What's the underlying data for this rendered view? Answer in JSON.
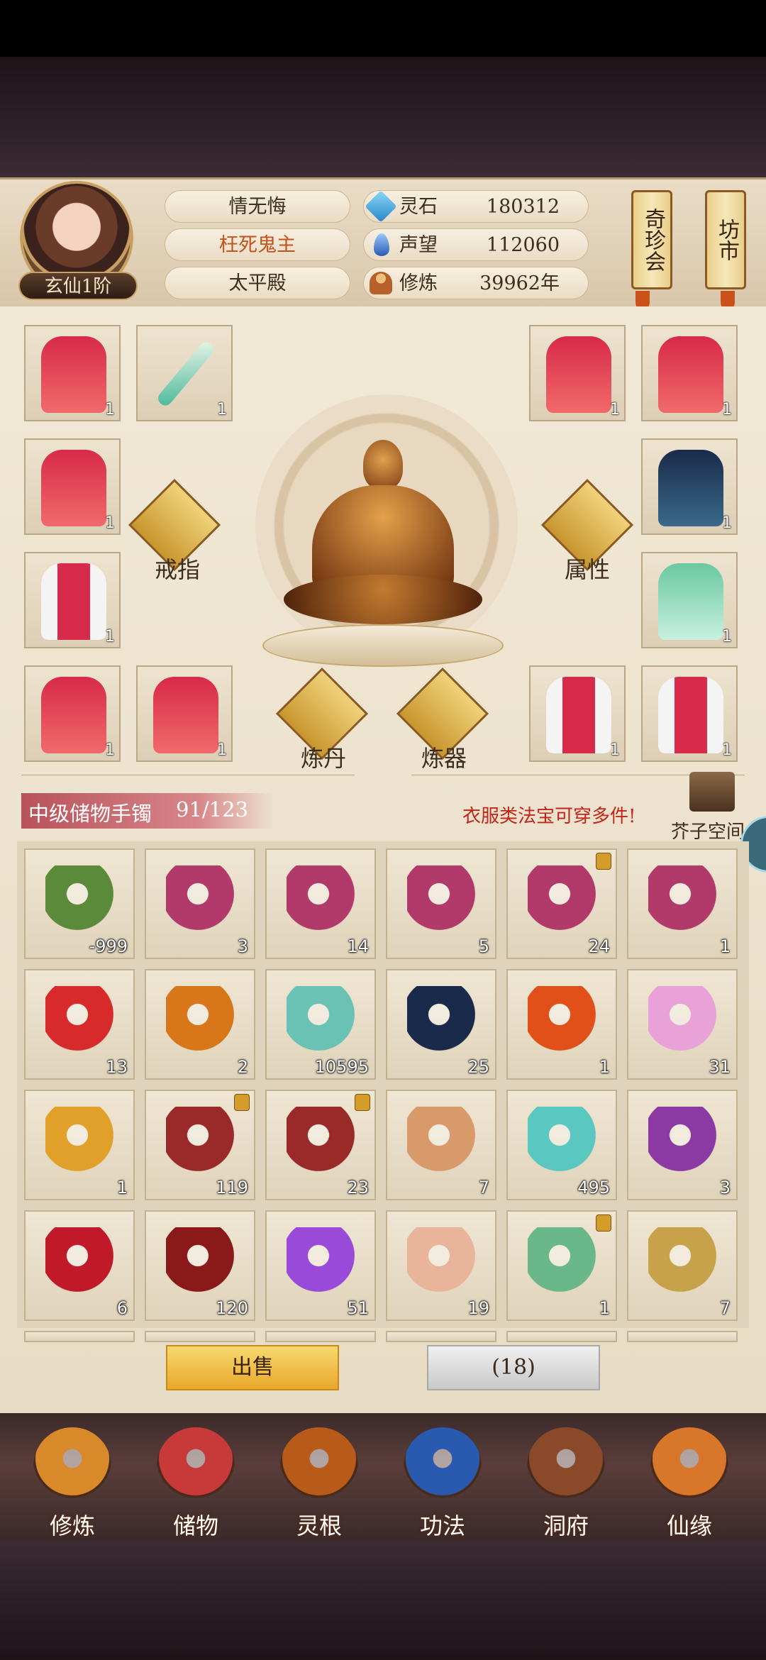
{
  "player": {
    "name": "情无悔",
    "title": "枉死鬼主",
    "sect": "太平殿",
    "rank": "玄仙1阶"
  },
  "stats": [
    {
      "label": "灵石",
      "value": "180312",
      "icon": "spirit-stone-icon",
      "color": "#3aa6d8"
    },
    {
      "label": "声望",
      "value": "112060",
      "icon": "reputation-icon",
      "color": "#4a7fd0"
    },
    {
      "label": "修炼",
      "value": "39962年",
      "icon": "cultivation-icon",
      "color": "#d48a3a"
    }
  ],
  "scrolls": {
    "treasure": "奇珍会",
    "market": "坊市"
  },
  "equip": {
    "ring_label": "戒指",
    "attr_label": "属性",
    "alchemy_label": "炼丹",
    "forge_label": "炼器",
    "slots": [
      {
        "count": "1",
        "icon": "red-robe-icon"
      },
      {
        "count": "1",
        "icon": "sword-icon"
      },
      {
        "count": "1",
        "icon": "red-robe-icon"
      },
      {
        "count": "1",
        "icon": "red-robe-icon"
      },
      {
        "count": "1",
        "icon": "red-robe-icon"
      },
      {
        "count": "1",
        "icon": "dark-robe-icon"
      },
      {
        "count": "1",
        "icon": "red-white-robe-icon"
      },
      {
        "count": "1",
        "icon": "green-robe-icon"
      },
      {
        "count": "1",
        "icon": "red-robe-icon"
      },
      {
        "count": "1",
        "icon": "red-robe-icon"
      },
      {
        "count": "1",
        "icon": "red-white-robe-icon"
      },
      {
        "count": "1",
        "icon": "red-white-robe-icon"
      }
    ]
  },
  "storage": {
    "name": "中级储物手镯",
    "capacity": "91/123",
    "hint": "衣服类法宝可穿多件!",
    "space_label": "芥子空间"
  },
  "items": [
    {
      "count": "-999",
      "icon": "branch-icon",
      "color": "#5a8a3a",
      "lock": false
    },
    {
      "count": "3",
      "icon": "scroll-icon",
      "color": "#b23a6a",
      "lock": false
    },
    {
      "count": "14",
      "icon": "scroll-icon",
      "color": "#b23a6a",
      "lock": false
    },
    {
      "count": "5",
      "icon": "scroll-icon",
      "color": "#b23a6a",
      "lock": false
    },
    {
      "count": "24",
      "icon": "scroll-icon",
      "color": "#b23a6a",
      "lock": true
    },
    {
      "count": "1",
      "icon": "scroll-icon",
      "color": "#b23a6a",
      "lock": false
    },
    {
      "count": "13",
      "icon": "red-orb-icon",
      "color": "#d82a2a",
      "lock": false
    },
    {
      "count": "2",
      "icon": "gourd-icon",
      "color": "#d8761a",
      "lock": false
    },
    {
      "count": "10595",
      "icon": "vase-icon",
      "color": "#6ac2b4",
      "lock": false
    },
    {
      "count": "25",
      "icon": "star-disc-icon",
      "color": "#1a2a4a",
      "lock": false
    },
    {
      "count": "1",
      "icon": "fire-dragon-icon",
      "color": "#e2501a",
      "lock": false
    },
    {
      "count": "31",
      "icon": "lotus-icon",
      "color": "#e8a2d8",
      "lock": false
    },
    {
      "count": "1",
      "icon": "golden-ring-icon",
      "color": "#e0a02a",
      "lock": false
    },
    {
      "count": "119",
      "icon": "rice-tray-icon",
      "color": "#9a2a2a",
      "lock": true
    },
    {
      "count": "23",
      "icon": "rice-tray-icon",
      "color": "#9a2a2a",
      "lock": true
    },
    {
      "count": "7",
      "icon": "ring-icon",
      "color": "#d89a6a",
      "lock": false
    },
    {
      "count": "495",
      "icon": "jade-cloud-icon",
      "color": "#5ac8c0",
      "lock": false
    },
    {
      "count": "3",
      "icon": "bonsai-icon",
      "color": "#8a3aa2",
      "lock": false
    },
    {
      "count": "6",
      "icon": "red-crystal-icon",
      "color": "#c01a2a",
      "lock": false
    },
    {
      "count": "120",
      "icon": "teapot-icon",
      "color": "#8a1a1a",
      "lock": false
    },
    {
      "count": "51",
      "icon": "purple-gem-icon",
      "color": "#9a4ad8",
      "lock": false
    },
    {
      "count": "19",
      "icon": "paper-scroll-icon",
      "color": "#e8b49a",
      "lock": false
    },
    {
      "count": "1",
      "icon": "green-robe-icon",
      "color": "#6ab88a",
      "lock": true
    },
    {
      "count": "7",
      "icon": "seed-pouch-icon",
      "color": "#c8a24a",
      "lock": false
    }
  ],
  "actions": {
    "sell": "出售",
    "count": "(18)"
  },
  "nav": [
    {
      "label": "修炼",
      "icon": "meditation-nav-icon",
      "color": "#d88a2a"
    },
    {
      "label": "储物",
      "icon": "bag-nav-icon",
      "color": "#c83a3a"
    },
    {
      "label": "灵根",
      "icon": "spirit-root-nav-icon",
      "color": "#b85a1a"
    },
    {
      "label": "功法",
      "icon": "book-nav-icon",
      "color": "#2a5ab0"
    },
    {
      "label": "洞府",
      "icon": "cave-nav-icon",
      "color": "#8a4a2a"
    },
    {
      "label": "仙缘",
      "icon": "gourd-nav-icon",
      "color": "#d8762a"
    }
  ]
}
